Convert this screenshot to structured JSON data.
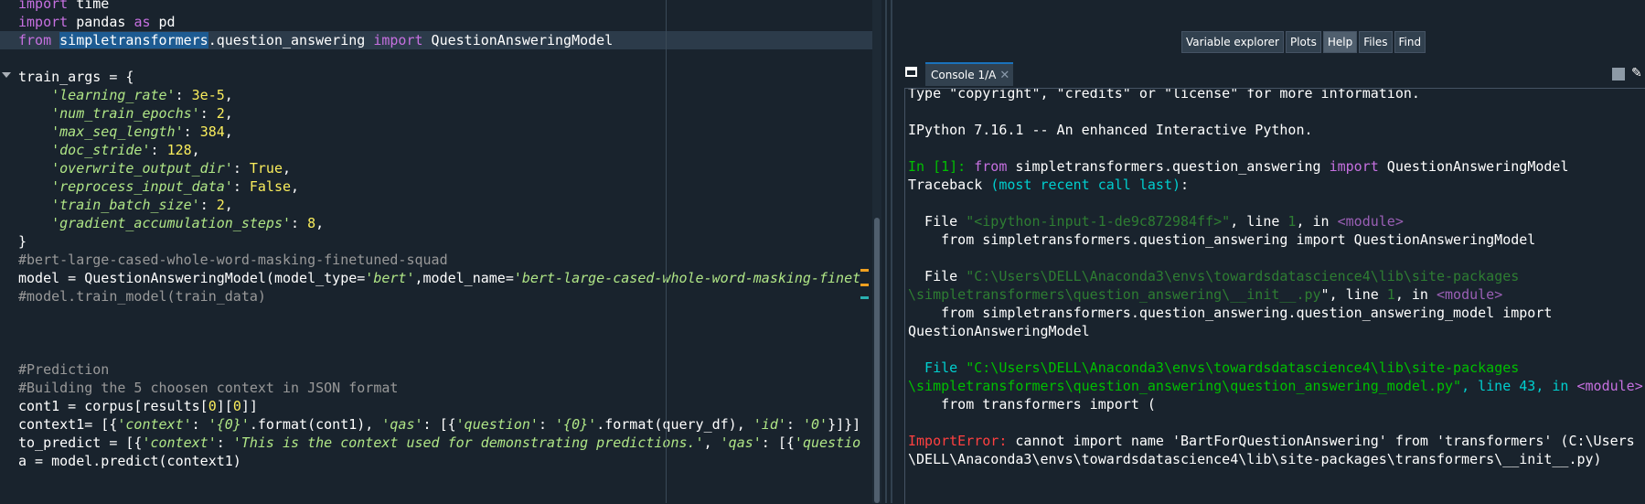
{
  "editor": {
    "lines": [
      [
        {
          "t": "import",
          "c": "kw"
        },
        {
          "t": " time"
        }
      ],
      [
        {
          "t": "import",
          "c": "kw"
        },
        {
          "t": " pandas "
        },
        {
          "t": "as",
          "c": "kw"
        },
        {
          "t": " pd"
        }
      ],
      [
        {
          "t": "from",
          "c": "kw"
        },
        {
          "t": " "
        },
        {
          "t": "simpletransformers",
          "c": "sel"
        },
        {
          "t": ".question_answering "
        },
        {
          "t": "import",
          "c": "kw"
        },
        {
          "t": " QuestionAnsweringModel"
        }
      ],
      [],
      [
        {
          "t": "train_args = {"
        }
      ],
      [
        {
          "t": "    "
        },
        {
          "t": "'learning_rate'",
          "c": "str"
        },
        {
          "t": ": "
        },
        {
          "t": "3e-5",
          "c": "num"
        },
        {
          "t": ","
        }
      ],
      [
        {
          "t": "    "
        },
        {
          "t": "'num_train_epochs'",
          "c": "str"
        },
        {
          "t": ": "
        },
        {
          "t": "2",
          "c": "num"
        },
        {
          "t": ","
        }
      ],
      [
        {
          "t": "    "
        },
        {
          "t": "'max_seq_length'",
          "c": "str"
        },
        {
          "t": ": "
        },
        {
          "t": "384",
          "c": "num"
        },
        {
          "t": ","
        }
      ],
      [
        {
          "t": "    "
        },
        {
          "t": "'doc_stride'",
          "c": "str"
        },
        {
          "t": ": "
        },
        {
          "t": "128",
          "c": "num"
        },
        {
          "t": ","
        }
      ],
      [
        {
          "t": "    "
        },
        {
          "t": "'overwrite_output_dir'",
          "c": "str"
        },
        {
          "t": ": "
        },
        {
          "t": "True",
          "c": "num"
        },
        {
          "t": ","
        }
      ],
      [
        {
          "t": "    "
        },
        {
          "t": "'reprocess_input_data'",
          "c": "str"
        },
        {
          "t": ": "
        },
        {
          "t": "False",
          "c": "num"
        },
        {
          "t": ","
        }
      ],
      [
        {
          "t": "    "
        },
        {
          "t": "'train_batch_size'",
          "c": "str"
        },
        {
          "t": ": "
        },
        {
          "t": "2",
          "c": "num"
        },
        {
          "t": ","
        }
      ],
      [
        {
          "t": "    "
        },
        {
          "t": "'gradient_accumulation_steps'",
          "c": "str"
        },
        {
          "t": ": "
        },
        {
          "t": "8",
          "c": "num"
        },
        {
          "t": ","
        }
      ],
      [
        {
          "t": "}"
        }
      ],
      [
        {
          "t": "#bert-large-cased-whole-word-masking-finetuned-squad",
          "c": "cm"
        }
      ],
      [
        {
          "t": "model = QuestionAnsweringModel(model_type="
        },
        {
          "t": "'bert'",
          "c": "str"
        },
        {
          "t": ",model_name="
        },
        {
          "t": "'bert-large-cased-whole-word-masking-finet",
          "c": "str"
        }
      ],
      [
        {
          "t": "#model.train_model(train_data)",
          "c": "cm"
        }
      ],
      [],
      [],
      [],
      [
        {
          "t": "#Prediction",
          "c": "cm"
        }
      ],
      [
        {
          "t": "#Building the 5 choosen context in JSON format",
          "c": "cm"
        }
      ],
      [
        {
          "t": "cont1 = corpus[results["
        },
        {
          "t": "0",
          "c": "num"
        },
        {
          "t": "]["
        },
        {
          "t": "0",
          "c": "num"
        },
        {
          "t": "]]"
        }
      ],
      [
        {
          "t": "context1= [{"
        },
        {
          "t": "'context'",
          "c": "str"
        },
        {
          "t": ": "
        },
        {
          "t": "'{0}'",
          "c": "str"
        },
        {
          "t": ".format(cont1), "
        },
        {
          "t": "'qas'",
          "c": "str"
        },
        {
          "t": ": [{"
        },
        {
          "t": "'question'",
          "c": "str"
        },
        {
          "t": ": "
        },
        {
          "t": "'{0}'",
          "c": "str"
        },
        {
          "t": ".format(query_df), "
        },
        {
          "t": "'id'",
          "c": "str"
        },
        {
          "t": ": "
        },
        {
          "t": "'0'",
          "c": "str"
        },
        {
          "t": "}]}]"
        }
      ],
      [
        {
          "t": "to_predict = [{"
        },
        {
          "t": "'context'",
          "c": "str"
        },
        {
          "t": ": "
        },
        {
          "t": "'This is the context used for demonstrating predictions.'",
          "c": "str"
        },
        {
          "t": ", "
        },
        {
          "t": "'qas'",
          "c": "str"
        },
        {
          "t": ": [{"
        },
        {
          "t": "'questio",
          "c": "str"
        }
      ],
      [
        {
          "t": "a = model.predict(context1)"
        }
      ]
    ]
  },
  "panes": {
    "tabs": [
      {
        "label": "Variable explorer",
        "active": false
      },
      {
        "label": "Plots",
        "active": false
      },
      {
        "label": "Help",
        "active": true
      },
      {
        "label": "Files",
        "active": false
      },
      {
        "label": "Find",
        "active": false
      }
    ]
  },
  "console": {
    "tab_label": "Console 1/A",
    "close_glyph": "✕",
    "lines": [
      [
        {
          "t": "Type \"copyright\", \"credits\" or \"license\" for more information."
        }
      ],
      [],
      [
        {
          "t": "IPython 7.16.1 -- An enhanced Interactive Python."
        }
      ],
      [],
      [
        {
          "t": "In [",
          "c": "cgreen"
        },
        {
          "t": "1",
          "c": "cgreen"
        },
        {
          "t": "]: ",
          "c": "cgreen"
        },
        {
          "t": "from",
          "c": "cpurple"
        },
        {
          "t": " simpletransformers.question_answering "
        },
        {
          "t": "import",
          "c": "cpurple"
        },
        {
          "t": " QuestionAnsweringModel"
        }
      ],
      [
        {
          "t": "Traceback "
        },
        {
          "t": "(most recent call last)",
          "c": "ccyan"
        },
        {
          "t": ":"
        }
      ],
      [],
      [
        {
          "t": "  File "
        },
        {
          "t": "\"<ipython-input-1-de9c872984ff>\"",
          "c": "cdimg"
        },
        {
          "t": ", line "
        },
        {
          "t": "1",
          "c": "cdimg"
        },
        {
          "t": ", in "
        },
        {
          "t": "<module>",
          "c": "cdimp"
        }
      ],
      [
        {
          "t": "    from simpletransformers.question_answering import QuestionAnsweringModel"
        }
      ],
      [],
      [
        {
          "t": "  File "
        },
        {
          "t": "\"C:\\Users\\DELL\\Anaconda3\\envs\\towardsdatascience4\\lib\\site-packages",
          "c": "cdimg"
        }
      ],
      [
        {
          "t": "\\simpletransformers\\question_answering\\__init__.py",
          "c": "cdimg"
        },
        {
          "t": "\", line "
        },
        {
          "t": "1",
          "c": "cdimg"
        },
        {
          "t": ", in "
        },
        {
          "t": "<module>",
          "c": "cdimp"
        }
      ],
      [
        {
          "t": "    from simpletransformers.question_answering.question_answering_model import"
        }
      ],
      [
        {
          "t": "QuestionAnsweringModel"
        }
      ],
      [],
      [
        {
          "t": "  File ",
          "c": "ccyan"
        },
        {
          "t": "\"C:\\Users\\DELL\\Anaconda3\\envs\\towardsdatascience4\\lib\\site-packages",
          "c": "cgreen"
        }
      ],
      [
        {
          "t": "\\simpletransformers\\question_answering\\question_answering_model.py\"",
          "c": "cgreen"
        },
        {
          "t": ", line 43, in ",
          "c": "ccyan"
        },
        {
          "t": "<module>",
          "c": "cpurple"
        }
      ],
      [
        {
          "t": "    from transformers import ("
        }
      ],
      [],
      [
        {
          "t": "ImportError:",
          "c": "cred"
        },
        {
          "t": " cannot import name 'BartForQuestionAnswering' from 'transformers' (C:\\Users"
        }
      ],
      [
        {
          "t": "\\DELL\\Anaconda3\\envs\\towardsdatascience4\\lib\\site-packages\\transformers\\__init__.py)"
        }
      ]
    ]
  },
  "toolbar": {
    "pencil_glyph": "✎"
  }
}
